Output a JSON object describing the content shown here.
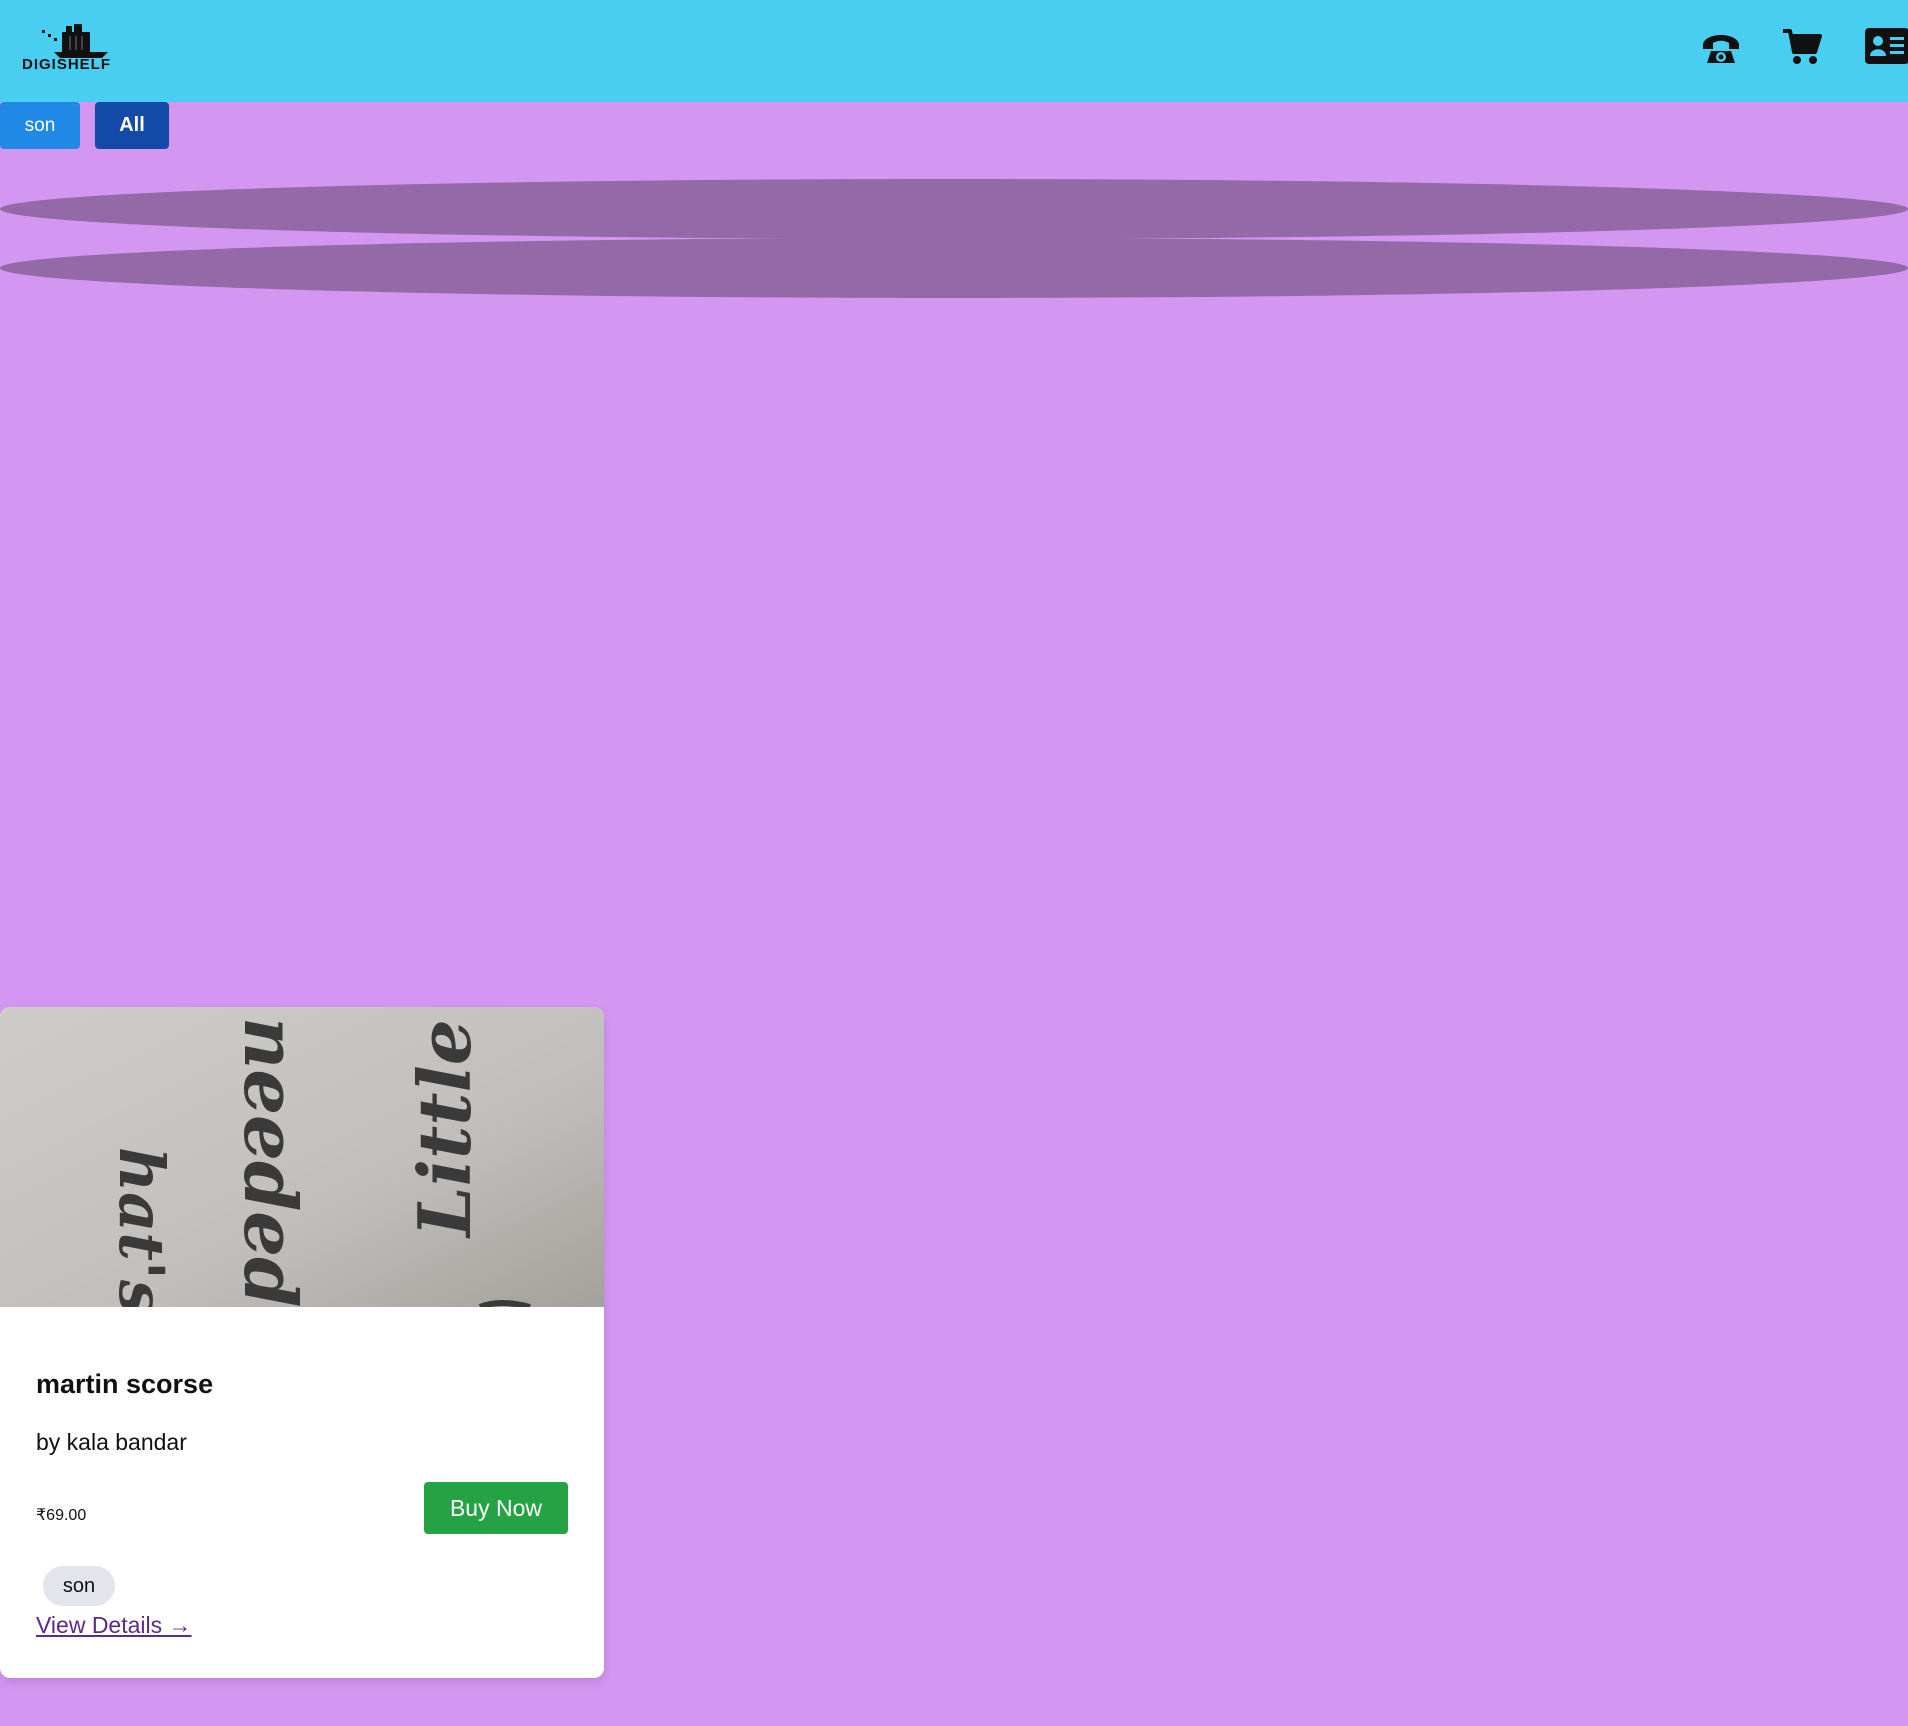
{
  "header": {
    "logo_text": "DIGISHELF",
    "icons": [
      "phone-icon",
      "cart-icon",
      "contact-card-icon"
    ]
  },
  "filters": {
    "son_label": "son",
    "all_label": "All"
  },
  "product": {
    "title": "martin scorse",
    "author": "by kala bandar",
    "price": "₹69.00",
    "buy_label": "Buy Now",
    "tag": "son",
    "details_link": "View Details →",
    "image_words": [
      "Little",
      "needed",
      "hat's"
    ]
  },
  "colors": {
    "header": "#48cef0",
    "background": "#d397f2",
    "ellipse": "#9369a8",
    "filter_son": "#2089e6",
    "filter_all": "#134aa8",
    "buy": "#25a244"
  }
}
